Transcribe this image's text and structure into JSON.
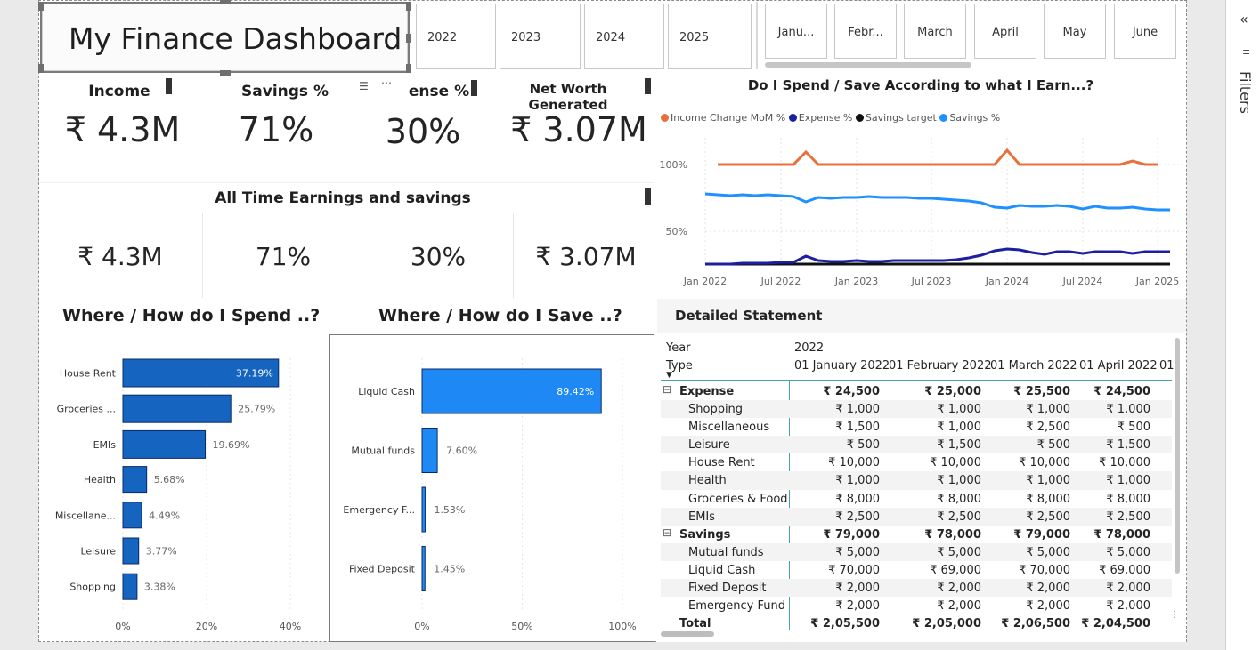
{
  "title": "My Finance Dashboard",
  "years": [
    "2022",
    "2023",
    "2024",
    "2025"
  ],
  "months": [
    "Janu...",
    "Febr...",
    "March",
    "April",
    "May",
    "June"
  ],
  "cards": [
    {
      "label": "Income",
      "value": "₹ 4.3M"
    },
    {
      "label": "Savings %",
      "value": "71%"
    },
    {
      "label": "ense %",
      "value": "30%"
    },
    {
      "label": "Net Worth Generated",
      "value": "₹ 3.07M"
    }
  ],
  "all_time": {
    "title": "All Time Earnings  and savings",
    "values": [
      "₹ 4.3M",
      "71%",
      "30%",
      "₹ 3.07M"
    ]
  },
  "line_chart": {
    "title": "Do I Spend / Save According to what I Earn...?",
    "legend": [
      {
        "name": "Income Change MoM %",
        "color": "#E8703A"
      },
      {
        "name": "Expense %",
        "color": "#1B1FA0"
      },
      {
        "name": "Savings target",
        "color": "#111111"
      },
      {
        "name": "Savings %",
        "color": "#1E90FF"
      }
    ],
    "y_ticks": [
      "100%",
      "50%"
    ],
    "x_ticks": [
      "Jan 2022",
      "Jul 2022",
      "Jan 2023",
      "Jul 2023",
      "Jan 2024",
      "Jul 2024",
      "Jan 2025"
    ]
  },
  "spend_chart": {
    "title": "Where / How do I Spend ..?",
    "categories": [
      "House Rent",
      "Groceries ...",
      "EMIs",
      "Health",
      "Miscellane...",
      "Leisure",
      "Shopping"
    ],
    "values": [
      37.19,
      25.79,
      19.69,
      5.68,
      4.49,
      3.77,
      3.38
    ],
    "labels": [
      "37.19%",
      "25.79%",
      "19.69%",
      "5.68%",
      "4.49%",
      "3.77%",
      "3.38%"
    ],
    "x_ticks": [
      "0%",
      "20%",
      "40%"
    ],
    "color": "#1565C0"
  },
  "save_chart": {
    "title": "Where / How do I Save ..?",
    "categories": [
      "Liquid Cash",
      "Mutual funds",
      "Emergency F...",
      "Fixed Deposit"
    ],
    "values": [
      89.42,
      7.6,
      1.53,
      1.45
    ],
    "labels": [
      "89.42%",
      "7.60%",
      "1.53%",
      "1.45%"
    ],
    "x_ticks": [
      "0%",
      "50%",
      "100%"
    ],
    "color": "#1E88F5"
  },
  "statement": {
    "title": "Detailed Statement",
    "year_label": "Year",
    "year_value": "2022",
    "type_label": "Type",
    "columns": [
      "01 January 2022",
      "01 February 2022",
      "01 March 2022",
      "01 April 2022",
      "01"
    ],
    "rows": [
      {
        "label": "Expense",
        "bold": true,
        "expand": true,
        "values": [
          "₹ 24,500",
          "₹ 25,000",
          "₹ 25,500",
          "₹ 24,500"
        ]
      },
      {
        "label": "Shopping",
        "values": [
          "₹ 1,000",
          "₹ 1,000",
          "₹ 1,000",
          "₹ 1,000"
        ]
      },
      {
        "label": "Miscellaneous",
        "values": [
          "₹ 1,500",
          "₹ 1,000",
          "₹ 2,500",
          "₹ 500"
        ]
      },
      {
        "label": "Leisure",
        "values": [
          "₹ 500",
          "₹ 1,500",
          "₹ 500",
          "₹ 1,500"
        ]
      },
      {
        "label": "House Rent",
        "values": [
          "₹ 10,000",
          "₹ 10,000",
          "₹ 10,000",
          "₹ 10,000"
        ]
      },
      {
        "label": "Health",
        "values": [
          "₹ 1,000",
          "₹ 1,000",
          "₹ 1,000",
          "₹ 1,000"
        ]
      },
      {
        "label": "Groceries & Food",
        "values": [
          "₹ 8,000",
          "₹ 8,000",
          "₹ 8,000",
          "₹ 8,000"
        ]
      },
      {
        "label": "EMIs",
        "values": [
          "₹ 2,500",
          "₹ 2,500",
          "₹ 2,500",
          "₹ 2,500"
        ]
      },
      {
        "label": "Savings",
        "bold": true,
        "expand": true,
        "values": [
          "₹ 79,000",
          "₹ 78,000",
          "₹ 79,000",
          "₹ 78,000"
        ]
      },
      {
        "label": "Mutual funds",
        "values": [
          "₹ 5,000",
          "₹ 5,000",
          "₹ 5,000",
          "₹ 5,000"
        ]
      },
      {
        "label": "Liquid Cash",
        "values": [
          "₹ 70,000",
          "₹ 69,000",
          "₹ 70,000",
          "₹ 69,000"
        ]
      },
      {
        "label": "Fixed Deposit",
        "values": [
          "₹ 2,000",
          "₹ 2,000",
          "₹ 2,000",
          "₹ 2,000"
        ]
      },
      {
        "label": "Emergency Fund",
        "values": [
          "₹ 2,000",
          "₹ 2,000",
          "₹ 2,000",
          "₹ 2,000"
        ]
      }
    ],
    "total": {
      "label": "Total",
      "values": [
        "₹ 2,05,500",
        "₹ 2,05,000",
        "₹ 2,06,500",
        "₹ 2,04,500"
      ]
    }
  },
  "filters": {
    "label": "Filters",
    "collapse_glyph": "«"
  }
}
